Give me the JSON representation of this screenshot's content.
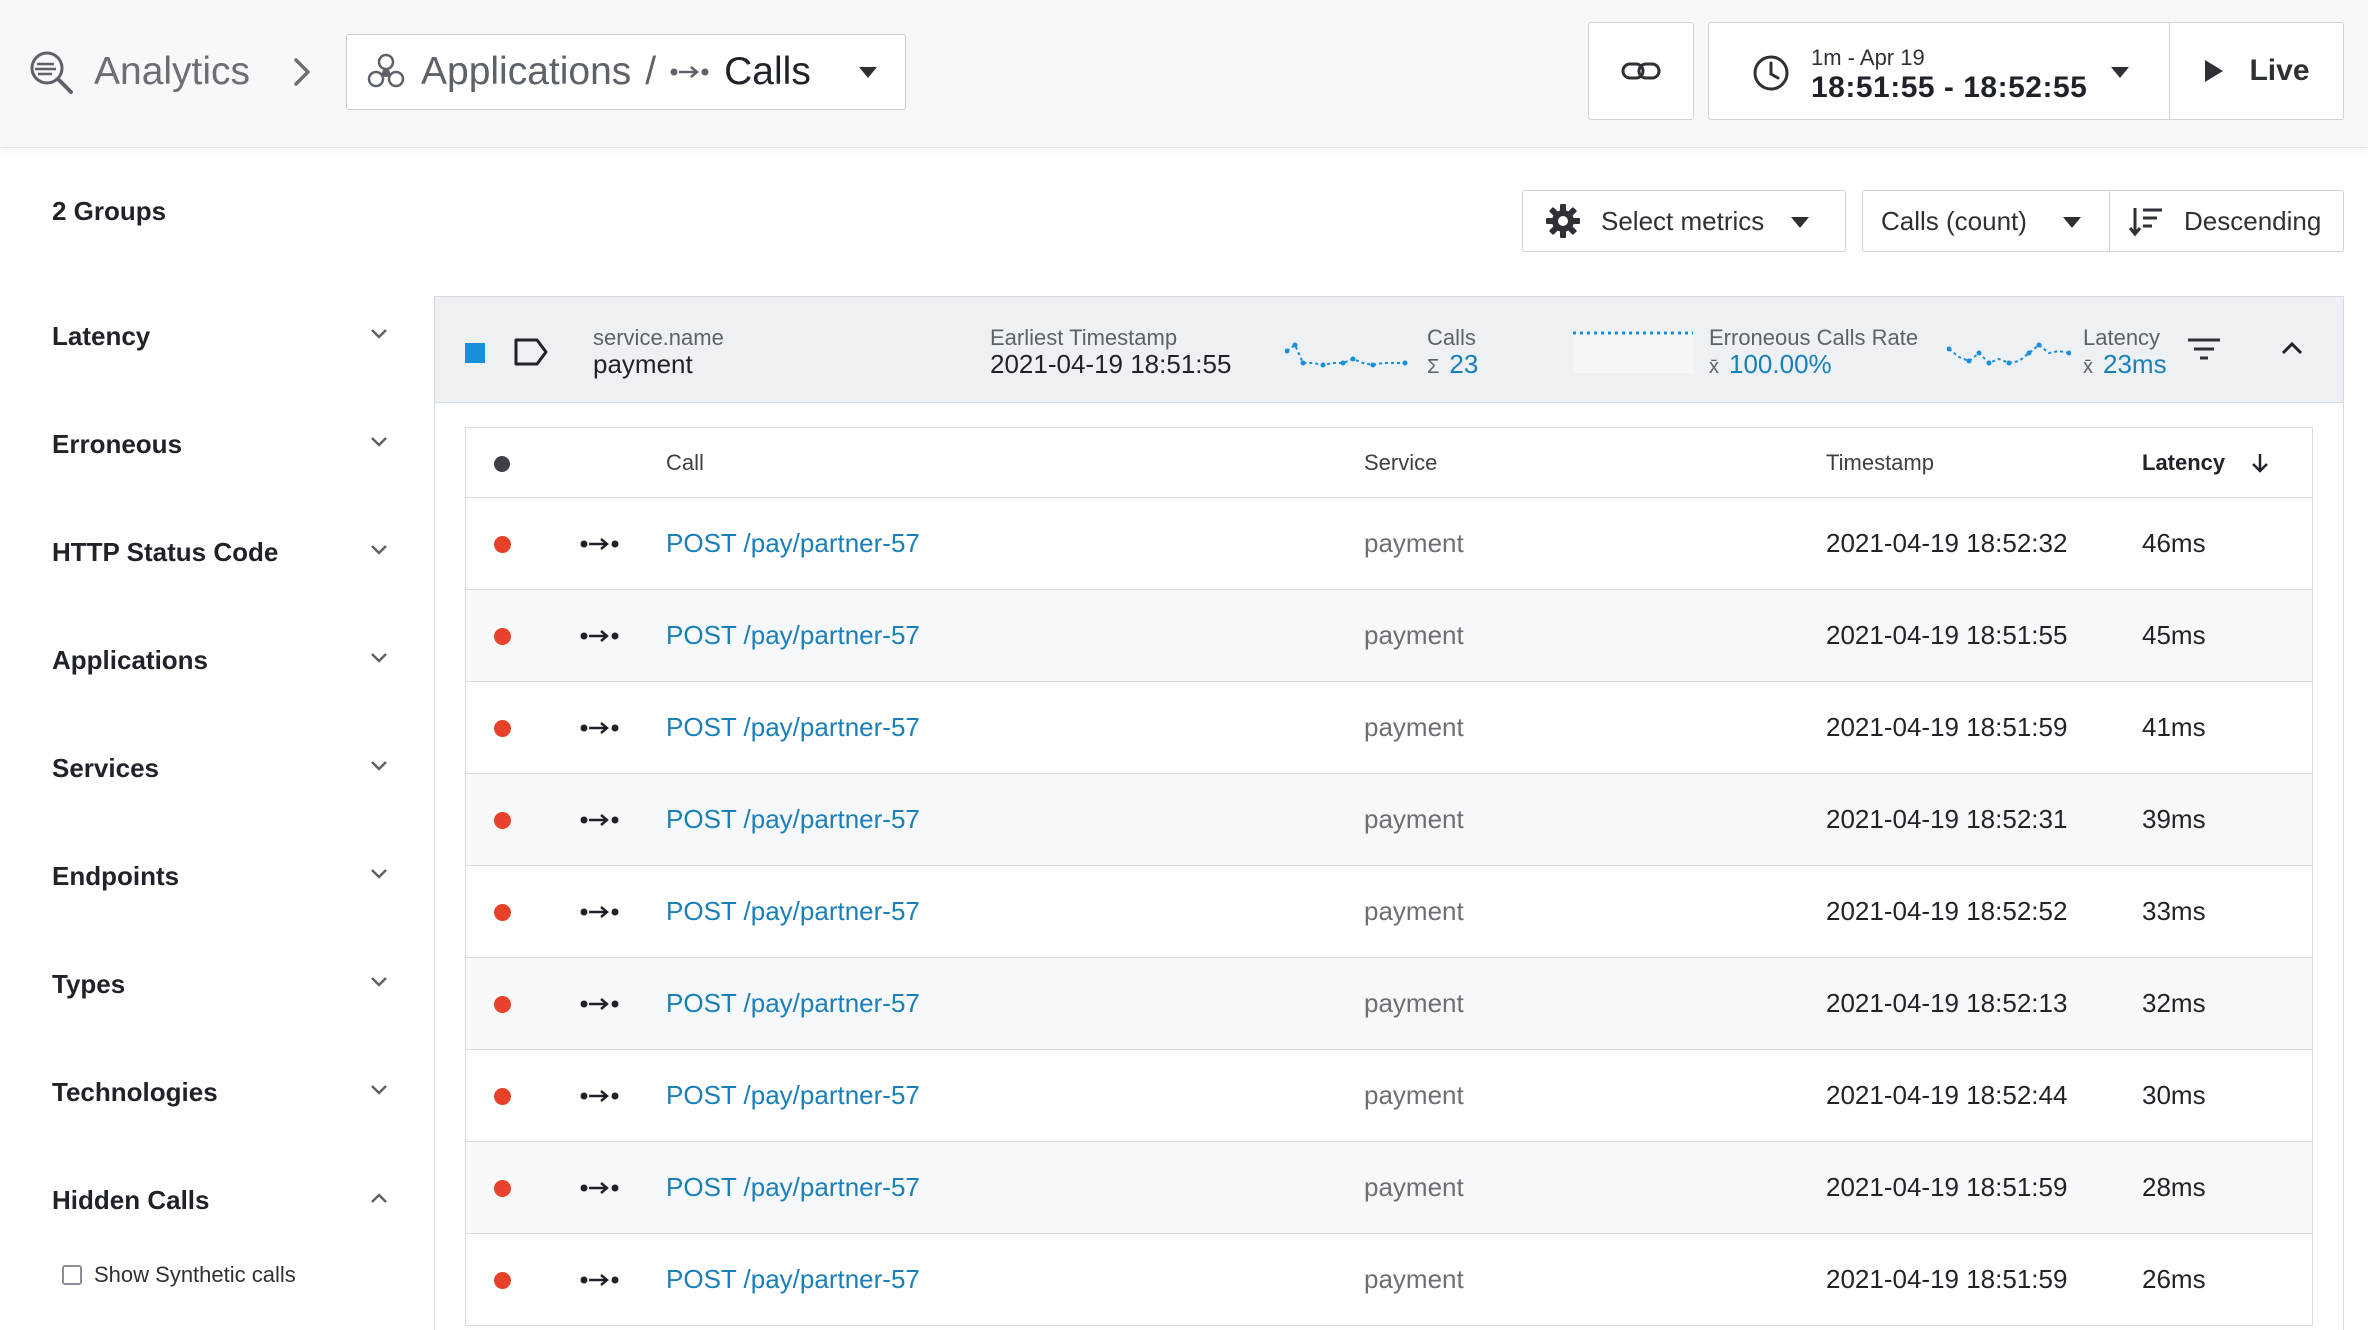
{
  "header": {
    "brand_label": "Analytics",
    "context": {
      "apps_label": "Applications",
      "separator": "/",
      "calls_label": "Calls"
    },
    "time": {
      "range_label": "1m - Apr 19",
      "span_label": "18:51:55 - 18:52:55"
    },
    "live_label": "Live"
  },
  "toolbar": {
    "groups_count": "2 Groups",
    "metrics_label": "Select metrics",
    "count_label": "Calls (count)",
    "sort_label": "Descending"
  },
  "sidebar": {
    "filters": [
      {
        "label": "Latency",
        "expanded": false
      },
      {
        "label": "Erroneous",
        "expanded": false
      },
      {
        "label": "HTTP Status Code",
        "expanded": false
      },
      {
        "label": "Applications",
        "expanded": false
      },
      {
        "label": "Services",
        "expanded": false
      },
      {
        "label": "Endpoints",
        "expanded": false
      },
      {
        "label": "Types",
        "expanded": false
      },
      {
        "label": "Technologies",
        "expanded": false
      },
      {
        "label": "Hidden Calls",
        "expanded": true
      }
    ],
    "synthetic_label": "Show Synthetic calls"
  },
  "group": {
    "swatch_color": "#1a8fd9",
    "key": "service.name",
    "value": "payment",
    "earliest_label": "Earliest Timestamp",
    "earliest_value": "2021-04-19 18:51:55",
    "calls_label": "Calls",
    "calls_prefix": "Σ",
    "calls_value": "23",
    "err_label": "Erroneous Calls Rate",
    "err_prefix": "x̄",
    "err_value": "100.00%",
    "latency_label": "Latency",
    "latency_prefix": "x̄",
    "latency_value": "23ms"
  },
  "table": {
    "headers": {
      "call": "Call",
      "service": "Service",
      "timestamp": "Timestamp",
      "latency": "Latency"
    },
    "rows": [
      {
        "call": "POST /pay/partner-57",
        "service": "payment",
        "timestamp": "2021-04-19 18:52:32",
        "latency": "46ms"
      },
      {
        "call": "POST /pay/partner-57",
        "service": "payment",
        "timestamp": "2021-04-19 18:51:55",
        "latency": "45ms"
      },
      {
        "call": "POST /pay/partner-57",
        "service": "payment",
        "timestamp": "2021-04-19 18:51:59",
        "latency": "41ms"
      },
      {
        "call": "POST /pay/partner-57",
        "service": "payment",
        "timestamp": "2021-04-19 18:52:31",
        "latency": "39ms"
      },
      {
        "call": "POST /pay/partner-57",
        "service": "payment",
        "timestamp": "2021-04-19 18:52:52",
        "latency": "33ms"
      },
      {
        "call": "POST /pay/partner-57",
        "service": "payment",
        "timestamp": "2021-04-19 18:52:13",
        "latency": "32ms"
      },
      {
        "call": "POST /pay/partner-57",
        "service": "payment",
        "timestamp": "2021-04-19 18:52:44",
        "latency": "30ms"
      },
      {
        "call": "POST /pay/partner-57",
        "service": "payment",
        "timestamp": "2021-04-19 18:51:59",
        "latency": "28ms"
      },
      {
        "call": "POST /pay/partner-57",
        "service": "payment",
        "timestamp": "2021-04-19 18:51:59",
        "latency": "26ms"
      }
    ]
  },
  "colors": {
    "error_dot": "#e8412b",
    "link": "#1a7fb8",
    "sparkline": "#1a8fd9"
  },
  "icons": {
    "brand": "analytics-magnifier-icon",
    "breadcrumb": "chevron-right-icon",
    "applications": "applications-cluster-icon",
    "calls": "call-arrow-icon",
    "link": "link-icon",
    "clock": "clock-icon",
    "play": "play-icon",
    "gear": "gear-icon",
    "sort": "sort-descending-icon",
    "tag": "tag-icon",
    "filter": "filter-icon"
  }
}
